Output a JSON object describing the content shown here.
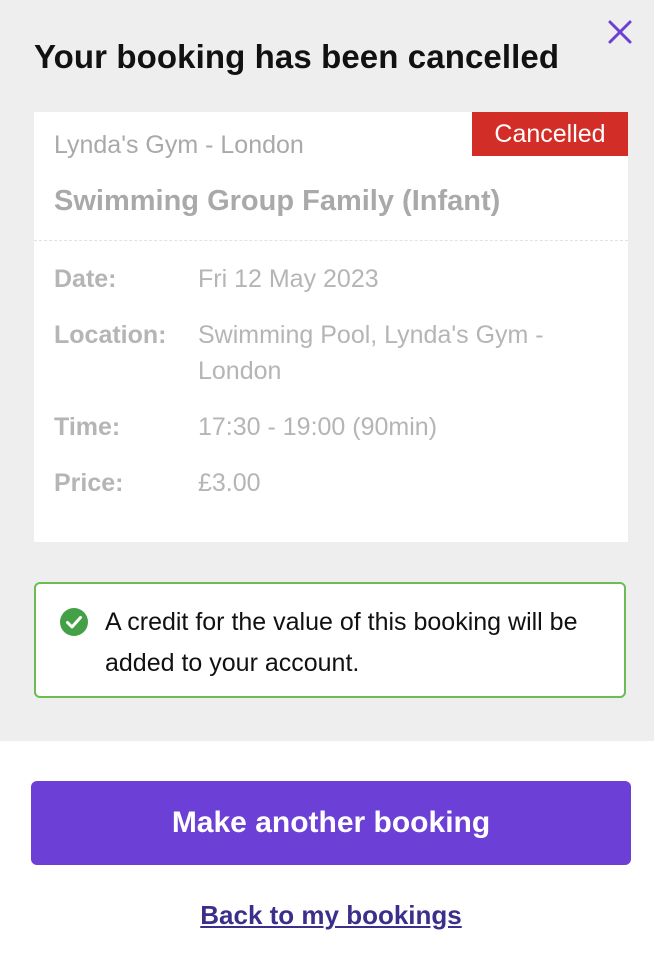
{
  "header": {
    "title": "Your booking has been cancelled",
    "close_icon": "close-icon"
  },
  "booking": {
    "status": "Cancelled",
    "venue": "Lynda's Gym - London",
    "class_name": "Swimming Group Family (Infant)",
    "details": [
      {
        "label": "Date:",
        "value": "Fri 12 May 2023"
      },
      {
        "label": "Location:",
        "value": "Swimming Pool, Lynda's Gym - London"
      },
      {
        "label": "Time:",
        "value": "17:30 - 19:00 (90min)"
      },
      {
        "label": "Price:",
        "value": "£3.00"
      }
    ]
  },
  "notice": {
    "icon": "check-circle-icon",
    "message": "A credit for the value of this booking will be added to your account."
  },
  "actions": {
    "primary_label": "Make another booking",
    "secondary_label": "Back to my bookings"
  },
  "colors": {
    "accent": "#6c3fd7",
    "status_cancelled": "#d32d27",
    "success": "#6cbb55",
    "link": "#3c2f8c"
  }
}
